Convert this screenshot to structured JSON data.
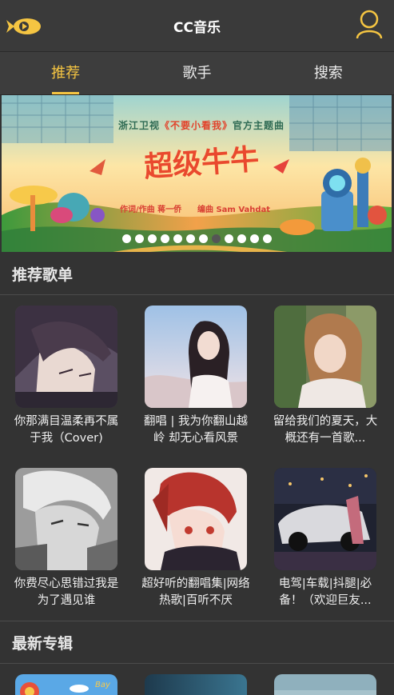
{
  "header": {
    "title": "CC音乐",
    "logo_icon": "fish-logo-icon",
    "user_icon": "user-icon",
    "accent_color": "#f5c542"
  },
  "tabs": [
    {
      "label": "推荐",
      "active": true
    },
    {
      "label": "歌手",
      "active": false
    },
    {
      "label": "搜索",
      "active": false
    }
  ],
  "banner": {
    "subtitle_prefix": "浙江卫视",
    "subtitle_show": "《不要小看我》",
    "subtitle_suffix": "官方主题曲",
    "title": "超级牛牛",
    "lyricist": "作词/作曲  蒋一侨",
    "arranger": "编曲  Sam Vahdat",
    "dot_count": 12,
    "active_dot": 7
  },
  "playlists": {
    "section_title": "推荐歌单",
    "items": [
      {
        "title": "你那满目温柔再不属于我（Cover)"
      },
      {
        "title": "翻唱 | 我为你翻山越岭 却无心看风景"
      },
      {
        "title": "留给我们的夏天，大概还有一首歌..."
      },
      {
        "title": "你费尽心思错过我是为了遇见谁"
      },
      {
        "title": "超好听的翻唱集|网络热歌|百听不厌"
      },
      {
        "title": "电驾|车载|抖腿|必备！（欢迎巨友..."
      }
    ]
  },
  "albums": {
    "section_title": "最新专辑"
  }
}
